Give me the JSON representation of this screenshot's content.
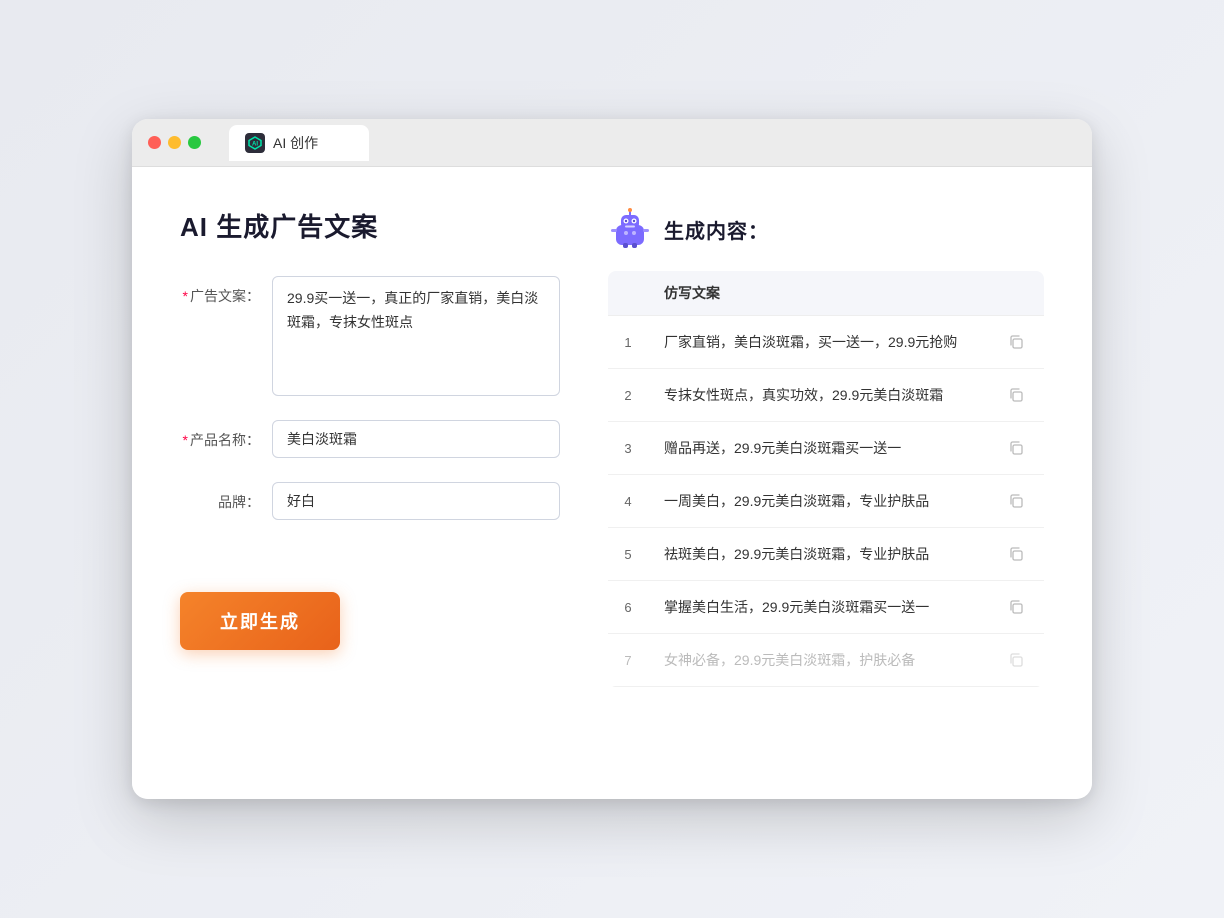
{
  "browser": {
    "tab_label": "AI 创作"
  },
  "page": {
    "title": "AI 生成广告文案"
  },
  "form": {
    "ad_copy_label": "广告文案：",
    "ad_copy_required": "*",
    "ad_copy_value": "29.9买一送一，真正的厂家直销，美白淡斑霜，专抹女性斑点",
    "product_name_label": "产品名称：",
    "product_name_required": "*",
    "product_name_value": "美白淡斑霜",
    "brand_label": "品牌：",
    "brand_value": "好白",
    "generate_btn_label": "立即生成"
  },
  "result": {
    "header_icon": "robot",
    "header_title": "生成内容：",
    "table_col_header": "仿写文案",
    "items": [
      {
        "num": 1,
        "text": "厂家直销，美白淡斑霜，买一送一，29.9元抢购",
        "faded": false
      },
      {
        "num": 2,
        "text": "专抹女性斑点，真实功效，29.9元美白淡斑霜",
        "faded": false
      },
      {
        "num": 3,
        "text": "赠品再送，29.9元美白淡斑霜买一送一",
        "faded": false
      },
      {
        "num": 4,
        "text": "一周美白，29.9元美白淡斑霜，专业护肤品",
        "faded": false
      },
      {
        "num": 5,
        "text": "祛斑美白，29.9元美白淡斑霜，专业护肤品",
        "faded": false
      },
      {
        "num": 6,
        "text": "掌握美白生活，29.9元美白淡斑霜买一送一",
        "faded": false
      },
      {
        "num": 7,
        "text": "女神必备，29.9元美白淡斑霜，护肤必备",
        "faded": true
      }
    ]
  }
}
